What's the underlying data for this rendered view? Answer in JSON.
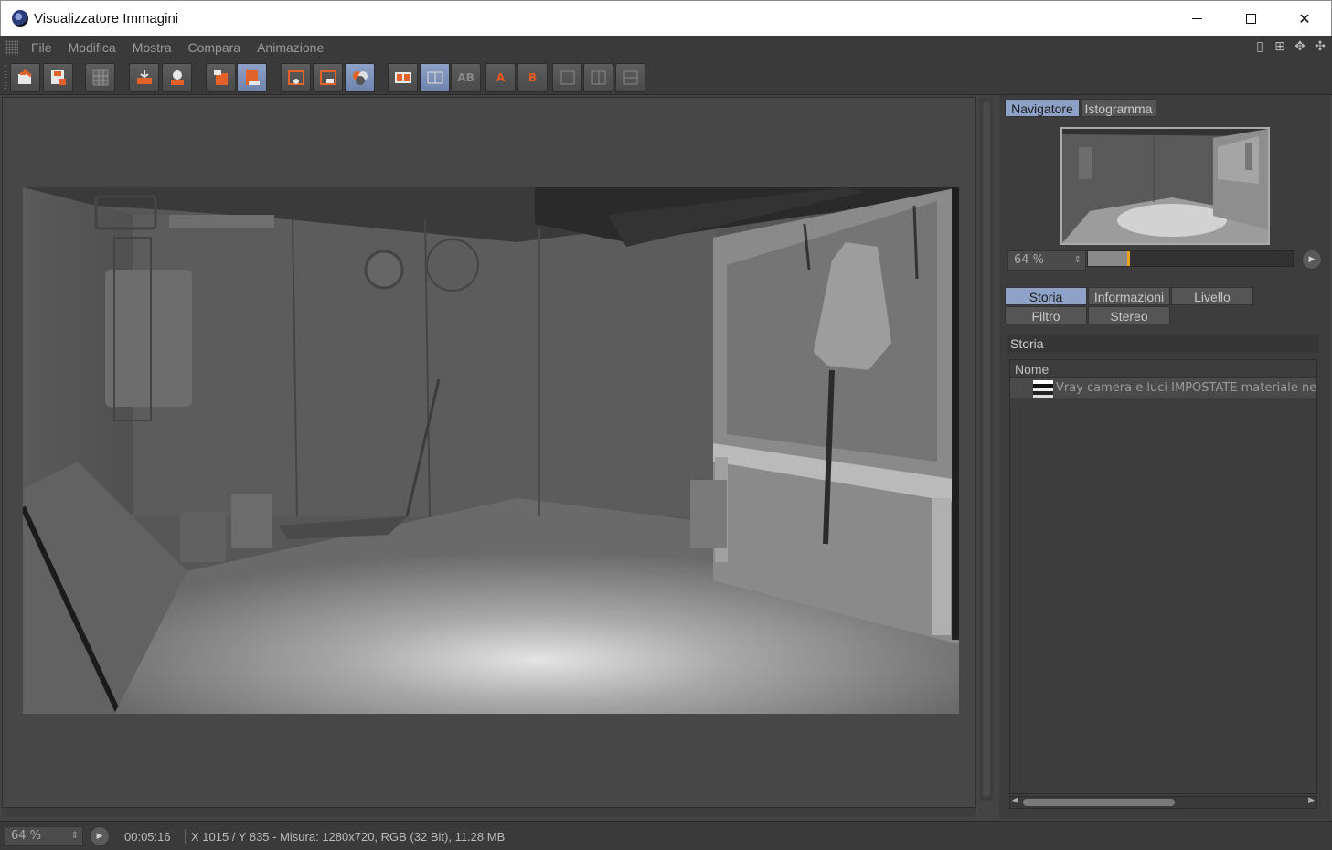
{
  "window": {
    "title": "Visualizzatore Immagini"
  },
  "menu": {
    "items": [
      "File",
      "Modifica",
      "Mostra",
      "Compara",
      "Animazione"
    ]
  },
  "toolbar": {
    "letter_a": "A",
    "letter_b": "B",
    "letters_ab": "AB"
  },
  "navigator": {
    "tabs": [
      "Navigatore",
      "Istogramma"
    ],
    "active_tab": "Navigatore",
    "zoom": "64 %",
    "zoom_fraction": 0.64
  },
  "info_panel": {
    "tabs": [
      "Storia",
      "Informazioni",
      "Livello",
      "Filtro",
      "Stereo"
    ],
    "active_tab": "Storia",
    "section_title": "Storia",
    "column_header": "Nome",
    "rows": [
      "Vray camera e luci IMPOSTATE materiale neutro"
    ]
  },
  "status": {
    "zoom": "64 %",
    "time": "00:05:16",
    "info": "X 1015 / Y 835 - Misura: 1280x720, RGB (32 Bit), 11.28 MB"
  },
  "colors": {
    "accent": "#8ea1c7",
    "orange": "#e2622a",
    "slider_knob": "#e9a21a",
    "background": "#444444"
  },
  "icons": [
    "app-icon",
    "open-icon",
    "save-icon",
    "grid-icon",
    "stack-icon",
    "user-icon",
    "delete-icon",
    "export-icon",
    "region-icon",
    "camera-icon",
    "channels-icon",
    "compare-ab-icon"
  ]
}
